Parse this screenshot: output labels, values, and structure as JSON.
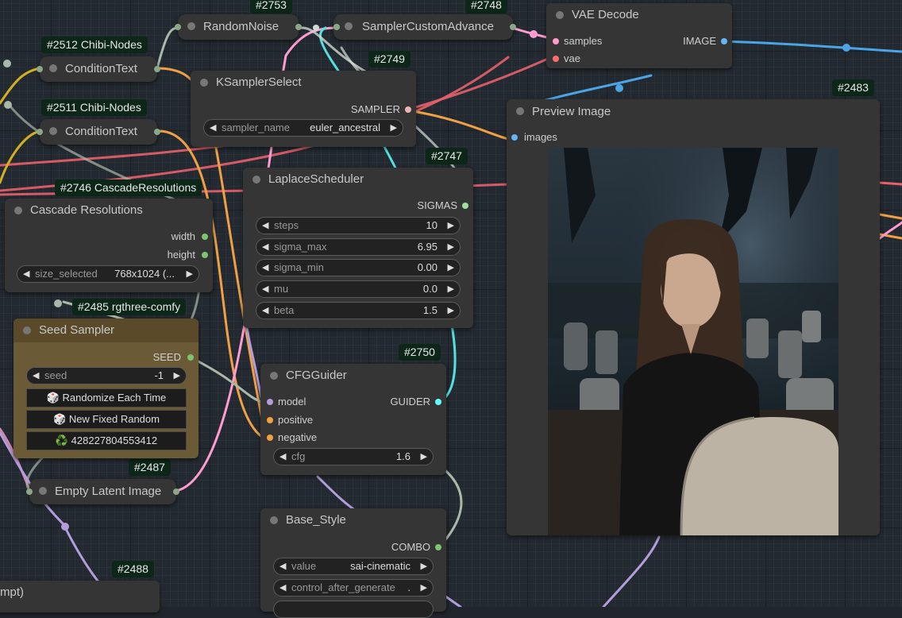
{
  "colors": {
    "clip": "#c9a026",
    "conditioning": "#f5a142",
    "latent": "#ff9ccf",
    "vae": "#ff6e6e",
    "image": "#64b5f6",
    "sigmas": "#ffffff",
    "guider": "#66ffff",
    "model": "#b39ddb",
    "int": "#7ec46f",
    "sampler": "#ecb4b4",
    "noise": "#b0b0b0"
  },
  "badges": {
    "n2753": "#2753",
    "n2748": "#2748",
    "n2512": "#2512 Chibi-Nodes",
    "n2511": "#2511 Chibi-Nodes",
    "n2749": "#2749",
    "n2483": "#2483",
    "n2747": "#2747",
    "n2746": "#2746 CascadeResolutions",
    "n2485": "#2485 rgthree-comfy",
    "n2750": "#2750",
    "n2487": "#2487",
    "n2488": "#2488"
  },
  "nodes": {
    "random_noise": {
      "title": "RandomNoise"
    },
    "sampler_custom_advance": {
      "title": "SamplerCustomAdvance"
    },
    "vae_decode": {
      "title": "VAE Decode",
      "in1": "samples",
      "in2": "vae",
      "out1": "IMAGE"
    },
    "condition_text_1": {
      "title": "ConditionText"
    },
    "condition_text_2": {
      "title": "ConditionText"
    },
    "ksampler_select": {
      "title": "KSamplerSelect",
      "out1": "SAMPLER",
      "w_label": "sampler_name",
      "w_value": "euler_ancestral"
    },
    "preview_image": {
      "title": "Preview Image",
      "in1": "images"
    },
    "laplace_scheduler": {
      "title": "LaplaceScheduler",
      "out1": "SIGMAS",
      "widgets": [
        {
          "label": "steps",
          "value": "10"
        },
        {
          "label": "sigma_max",
          "value": "6.95"
        },
        {
          "label": "sigma_min",
          "value": "0.00"
        },
        {
          "label": "mu",
          "value": "0.0"
        },
        {
          "label": "beta",
          "value": "1.5"
        }
      ]
    },
    "cascade_resolutions": {
      "title": "Cascade Resolutions",
      "out1": "width",
      "out2": "height",
      "w_label": "size_selected",
      "w_value": "768x1024 (..."
    },
    "seed_sampler": {
      "title": "Seed Sampler",
      "out1": "SEED",
      "w_label": "seed",
      "w_value": "-1",
      "btn1": "🎲 Randomize Each Time",
      "btn2": "🎲 New Fixed Random",
      "btn3": "♻️ 428227804553412"
    },
    "cfg_guider": {
      "title": "CFGGuider",
      "in1": "model",
      "in2": "positive",
      "in3": "negative",
      "out1": "GUIDER",
      "w_label": "cfg",
      "w_value": "1.6"
    },
    "empty_latent": {
      "title": "Empty Latent Image"
    },
    "base_style": {
      "title": "Base_Style",
      "out1": "COMBO",
      "w1_label": "value",
      "w1_value": "sai-cinematic",
      "w2_label": "control_after_generate",
      "w2_value": "."
    },
    "partial_node": {
      "title": "mpt)"
    }
  }
}
